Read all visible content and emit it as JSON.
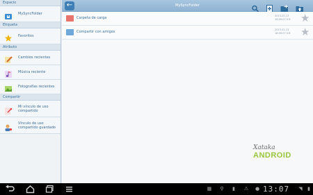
{
  "sidebar": {
    "sections": [
      {
        "header": "Espacio",
        "items": [
          {
            "label": "MySyncFolder",
            "icon": "lock-folder-icon"
          }
        ]
      },
      {
        "header": "Etiqueta",
        "items": [
          {
            "label": "Favoritos",
            "icon": "star-icon"
          }
        ]
      },
      {
        "header": "Atributo",
        "items": [
          {
            "label": "Cambios recientes",
            "icon": "edit-icon"
          },
          {
            "label": "Música reciente",
            "icon": "music-icon"
          },
          {
            "label": "Fotografías recientes",
            "icon": "photo-icon"
          }
        ]
      },
      {
        "header": "Compartir",
        "items": [
          {
            "label": "Mi vínculo de uso compartido",
            "icon": "link-icon"
          },
          {
            "label": "Vínculo de uso compartido guardado",
            "icon": "person-link-icon"
          }
        ]
      }
    ]
  },
  "toolbar": {
    "title": "MySyncFolder",
    "back_icon": "back-arrow-icon",
    "icons": [
      "search-icon",
      "new-file-icon",
      "new-folder-icon",
      "upload-icon"
    ]
  },
  "files": [
    {
      "name": "Carpeta de carga",
      "date_line1": "2013-02-13",
      "date_line2": "18:09:07 0 B",
      "color": "#e8746e"
    },
    {
      "name": "Compartir con amigos",
      "date_line1": "2013-02-13",
      "date_line2": "18:09:07 0 B",
      "color": "#6fa9dc"
    }
  ],
  "watermark": {
    "line1": "Xataka",
    "line2": "ANDROID"
  },
  "statusbar": {
    "time": "13:07"
  },
  "colors": {
    "accent": "#3f7fb5",
    "header_text": "#3a6f9f",
    "android_green": "#9bc53d"
  }
}
